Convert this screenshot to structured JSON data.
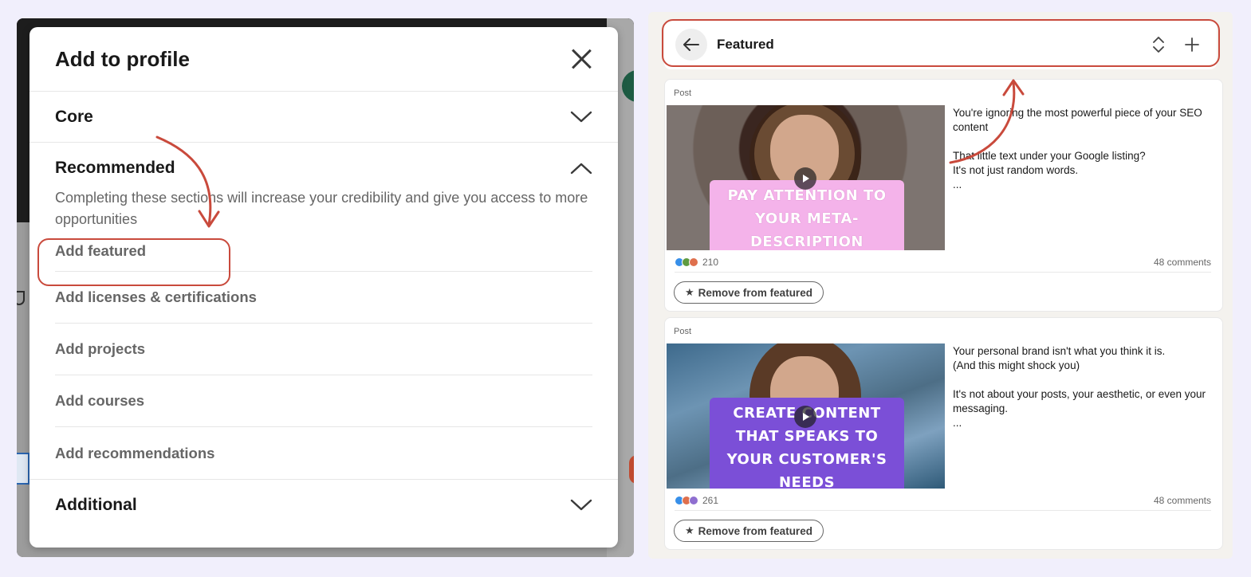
{
  "modal": {
    "title": "Add to profile",
    "close_icon": "close-icon",
    "sections": {
      "core": {
        "title": "Core",
        "icon": "chevron-down-icon"
      },
      "recommended": {
        "title": "Recommended",
        "icon": "chevron-up-icon",
        "description": "Completing these sections will increase your credibility and give you access to more opportunities",
        "items": [
          {
            "label": "Add featured"
          },
          {
            "label": "Add licenses & certifications"
          },
          {
            "label": "Add projects"
          },
          {
            "label": "Add courses"
          },
          {
            "label": "Add recommendations"
          }
        ]
      },
      "additional": {
        "title": "Additional",
        "icon": "chevron-down-icon"
      }
    }
  },
  "featured": {
    "title": "Featured",
    "icons": [
      "arrow-left-icon",
      "reorder-icon",
      "plus-icon"
    ],
    "posts": [
      {
        "type_label": "Post",
        "thumbnail_caption": "PAY ATTENTION TO YOUR META-DESCRIPTION",
        "text": "You're ignoring the most powerful piece of your SEO content\n\nThat little text under your Google listing?\nIt's not just random words.\n...",
        "reaction_count": "210",
        "comments": "48 comments",
        "remove_label": "Remove from featured"
      },
      {
        "type_label": "Post",
        "thumbnail_caption": "CREATE CONTENT THAT SPEAKS TO YOUR CUSTOMER'S NEEDS",
        "text": "Your personal brand isn't what you think it is.\n(And this might shock you)\n\nIt's not about your posts, your aesthetic, or even your messaging.\n...",
        "reaction_count": "261",
        "comments": "48 comments",
        "remove_label": "Remove from featured"
      }
    ]
  },
  "colors": {
    "background": "#f1effc",
    "annotation": "#c94a3c",
    "muted_text": "#666666"
  }
}
